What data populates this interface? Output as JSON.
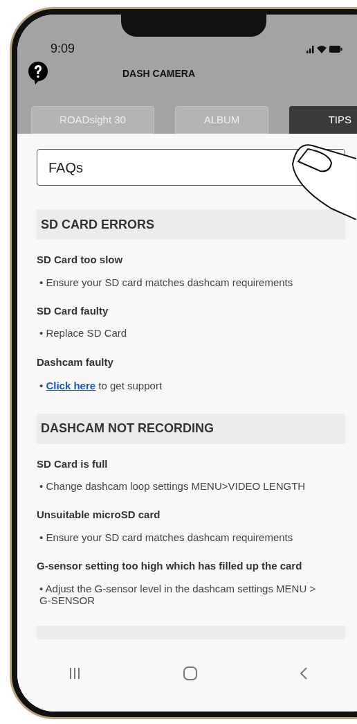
{
  "status_bar": {
    "time": "9:09"
  },
  "header": {
    "title": "DASH CAMERA"
  },
  "tabs": [
    {
      "label": "ROADsight 30",
      "selected": false
    },
    {
      "label": "ALBUM",
      "selected": false
    },
    {
      "label": "TIPS",
      "selected": true
    }
  ],
  "faq_select": {
    "value": "FAQs"
  },
  "sections": [
    {
      "title": "SD CARD ERRORS",
      "items": [
        {
          "question": "SD Card too slow",
          "answer": "• Ensure your SD card matches dashcam requirements"
        },
        {
          "question": "SD Card faulty",
          "answer": "• Replace SD Card"
        },
        {
          "question": "Dashcam faulty",
          "bullet": "•",
          "link": "Click here",
          "answer": "to get support"
        }
      ]
    },
    {
      "title": "DASHCAM NOT RECORDING",
      "items": [
        {
          "question": "SD Card is full",
          "answer": "• Change dashcam loop settings MENU>VIDEO LENGTH"
        },
        {
          "question": "Unsuitable microSD card",
          "answer": "• Ensure your SD card matches dashcam requirements"
        },
        {
          "question": "G-sensor setting too high which has filled up the card",
          "answer": "• Adjust the G-sensor level in the dashcam settings MENU > G-SENSOR"
        }
      ]
    }
  ]
}
